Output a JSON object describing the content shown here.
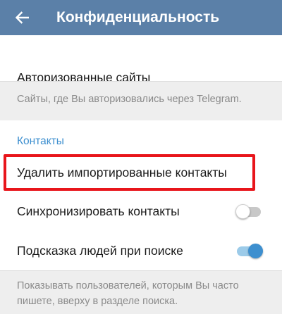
{
  "header": {
    "title": "Конфиденциальность",
    "bg_color": "#5b80a8"
  },
  "rows": {
    "authorized_sites": "Авторизованные сайты",
    "authorized_sites_hint": "Сайты, где Вы авторизовались через Telegram.",
    "contacts_section": "Контакты",
    "delete_imported": "Удалить импортированные контакты",
    "sync_contacts": "Синхронизировать контакты",
    "suggest_people": "Подсказка людей при поиске",
    "suggest_hint": "Показывать пользователей, которым Вы часто пишете, вверху в разделе поиска."
  },
  "toggles": {
    "sync_contacts_on": false,
    "suggest_people_on": true
  },
  "colors": {
    "accent": "#3d8fcf",
    "highlight": "#e8151b"
  },
  "icons": {
    "back": "arrow-left-icon"
  }
}
